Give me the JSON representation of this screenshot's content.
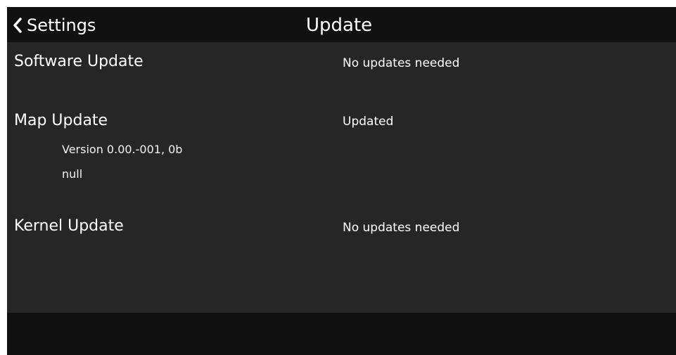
{
  "header": {
    "back_label": "Settings",
    "title": "Update",
    "back_icon": "chevron-left-icon"
  },
  "rows": [
    {
      "label": "Software Update",
      "status": "No updates needed"
    },
    {
      "label": "Map Update",
      "status": "Updated",
      "details": [
        "Version 0.00.-001, 0b",
        "null"
      ]
    },
    {
      "label": "Kernel Update",
      "status": "No updates needed"
    }
  ],
  "colors": {
    "background": "#262626",
    "header_bar": "#111111",
    "text": "#ffffff"
  }
}
